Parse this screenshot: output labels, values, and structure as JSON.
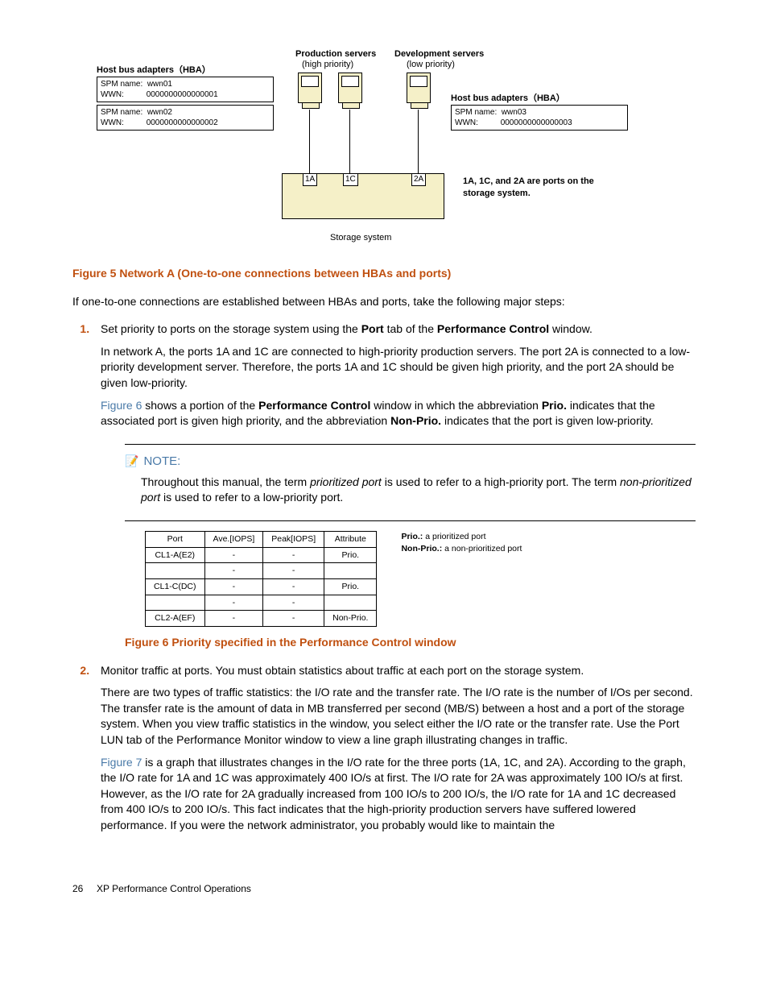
{
  "diagram": {
    "hba_title_left": "Host bus adapters（HBA）",
    "hba_title_right": "Host bus adapters（HBA）",
    "prod_label": "Production servers",
    "prod_sub": "(high priority)",
    "dev_label": "Development servers",
    "dev_sub": "(low priority)",
    "hba_left": [
      {
        "spm_label": "SPM name:",
        "spm_val": "wwn01",
        "wwn_label": "WWN:",
        "wwn_val": "0000000000000001"
      },
      {
        "spm_label": "SPM name:",
        "spm_val": "wwn02",
        "wwn_label": "WWN:",
        "wwn_val": "0000000000000002"
      }
    ],
    "hba_right": {
      "spm_label": "SPM name:",
      "spm_val": "wwn03",
      "wwn_label": "WWN:",
      "wwn_val": "0000000000000003"
    },
    "ports": [
      "1A",
      "1C",
      "2A"
    ],
    "port_note": "1A, 1C, and 2A are ports on the storage system.",
    "storage_label": "Storage system"
  },
  "fig5_caption": "Figure 5 Network A (One-to-one connections between HBAs and ports)",
  "intro": "If one-to-one connections are established between HBAs and ports, take the following major steps:",
  "step1": {
    "lead_a": "Set priority to ports on the storage system using the ",
    "bold_port": "Port",
    "lead_b": " tab of the ",
    "bold_pc": "Performance Control",
    "lead_c": " window.",
    "para2": "In network A, the ports 1A and 1C are connected to high-priority production servers. The port 2A is connected to a low-priority development server. Therefore, the ports 1A and 1C should be given high priority, and the port 2A should be given low-priority.",
    "p3_link": "Figure 6",
    "p3_a": " shows a portion of the ",
    "p3_bold1": "Performance Control",
    "p3_b": " window in which the abbreviation ",
    "p3_bold2": "Prio.",
    "p3_c": " indicates that the associated port is given high priority, and the abbreviation ",
    "p3_bold3": "Non-Prio.",
    "p3_d": " indicates that the port is given low-priority."
  },
  "note": {
    "label": "NOTE:",
    "body_a": "Throughout this manual, the term ",
    "italic1": "prioritized port",
    "body_b": " is used to refer to a high-priority port. The term ",
    "italic2": "non-prioritized port",
    "body_c": " is used to refer to a low-priority port."
  },
  "table6": {
    "headers": [
      "Port",
      "Ave.[IOPS]",
      "Peak[IOPS]",
      "Attribute"
    ],
    "rows": [
      [
        "CL1-A(E2)",
        "-",
        "-",
        "Prio."
      ],
      [
        "",
        "-",
        "-",
        ""
      ],
      [
        "CL1-C(DC)",
        "-",
        "-",
        "Prio."
      ],
      [
        "",
        "-",
        "-",
        ""
      ],
      [
        "CL2-A(EF)",
        "-",
        "-",
        "Non-Prio."
      ]
    ],
    "legend_prio_b": "Prio.:",
    "legend_prio": " a prioritized port",
    "legend_nonprio_b": "Non-Prio.:",
    "legend_nonprio": " a non-prioritized port"
  },
  "fig6_caption": "Figure 6 Priority specified in the Performance Control window",
  "step2": {
    "lead": "Monitor traffic at ports. You must obtain statistics about traffic at each port on the storage system.",
    "para2": "There are two types of traffic statistics: the I/O rate and the transfer rate. The I/O rate is the number of I/Os per second. The transfer rate is the amount of data in MB transferred per second (MB/S) between a host and a port of the storage system. When you view traffic statistics in the window, you select either the I/O rate or the transfer rate. Use the Port LUN tab of the Performance Monitor window to view a line graph illustrating changes in traffic.",
    "p3_link": "Figure 7",
    "p3_body": " is a graph that illustrates changes in the I/O rate for the three ports (1A, 1C, and 2A). According to the graph, the I/O rate for 1A and 1C was approximately 400 IO/s at first. The I/O rate for 2A was approximately 100 IO/s at first. However, as the I/O rate for 2A gradually increased from 100 IO/s to 200 IO/s, the I/O rate for 1A and 1C decreased from 400 IO/s to 200 IO/s. This fact indicates that the high-priority production servers have suffered lowered performance. If you were the network administrator, you probably would like to maintain the"
  },
  "footer": {
    "page": "26",
    "title": "XP Performance Control Operations"
  }
}
